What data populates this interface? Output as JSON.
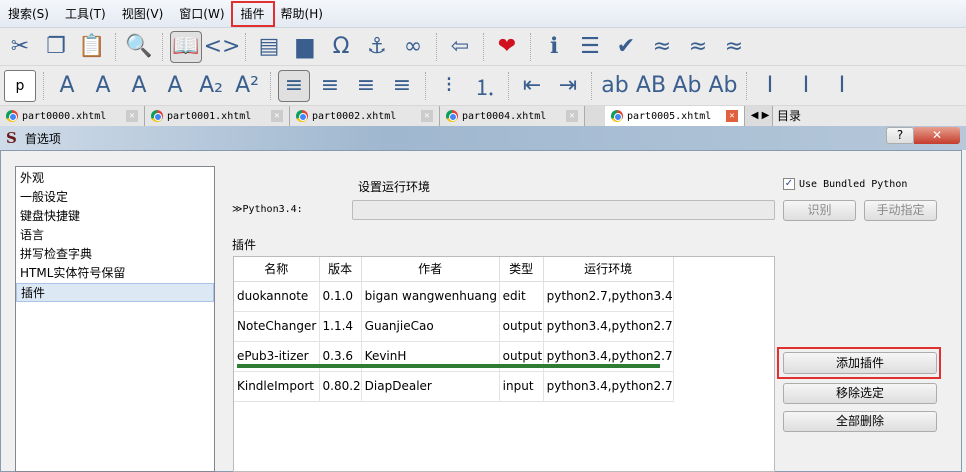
{
  "menu": [
    "搜索(S)",
    "工具(T)",
    "视图(V)",
    "窗口(W)",
    "插件",
    "帮助(H)"
  ],
  "toolbar1": [
    {
      "icon": "cut-icon",
      "g": "✂"
    },
    {
      "icon": "copy-icon",
      "g": "❐"
    },
    {
      "icon": "paste-icon",
      "g": "📋"
    },
    {
      "icon": "preview-icon",
      "g": "🔍"
    },
    {
      "icon": "book-view-icon",
      "g": "📖"
    },
    {
      "icon": "code-view-icon",
      "g": "<>"
    },
    {
      "icon": "split-icon",
      "g": "▤"
    },
    {
      "icon": "image-icon",
      "g": "▆"
    },
    {
      "icon": "omega-icon",
      "g": "Ω"
    },
    {
      "icon": "anchor-icon",
      "g": "⚓"
    },
    {
      "icon": "link-icon",
      "g": "∞"
    },
    {
      "icon": "back-icon",
      "g": "⇦"
    },
    {
      "icon": "heart-icon",
      "g": "❤"
    },
    {
      "icon": "info-icon",
      "g": "ℹ"
    },
    {
      "icon": "toc-icon",
      "g": "☰"
    },
    {
      "icon": "spellcheck-icon",
      "g": "✔"
    },
    {
      "icon": "clean-icon",
      "g": "≈"
    },
    {
      "icon": "clean2-icon",
      "g": "≈"
    },
    {
      "icon": "clean3-icon",
      "g": "≈"
    }
  ],
  "toolbar2": [
    {
      "icon": "paragraph-icon",
      "g": "p"
    },
    {
      "icon": "bold-icon",
      "g": "A"
    },
    {
      "icon": "italic-icon",
      "g": "A"
    },
    {
      "icon": "underline-icon",
      "g": "A"
    },
    {
      "icon": "strike-icon",
      "g": "A"
    },
    {
      "icon": "subscript-icon",
      "g": "A₂"
    },
    {
      "icon": "superscript-icon",
      "g": "A²"
    },
    {
      "icon": "align-left-icon",
      "g": "≡"
    },
    {
      "icon": "align-center-icon",
      "g": "≡"
    },
    {
      "icon": "align-right-icon",
      "g": "≡"
    },
    {
      "icon": "justify-icon",
      "g": "≡"
    },
    {
      "icon": "bullet-list-icon",
      "g": "⁝"
    },
    {
      "icon": "number-list-icon",
      "g": "⒈"
    },
    {
      "icon": "outdent-icon",
      "g": "⇤"
    },
    {
      "icon": "indent-icon",
      "g": "⇥"
    },
    {
      "icon": "lowercase-icon",
      "g": "ab"
    },
    {
      "icon": "uppercase-icon",
      "g": "AB"
    },
    {
      "icon": "titlecase-icon",
      "g": "Ab"
    },
    {
      "icon": "capitalize-icon",
      "g": "Ab"
    },
    {
      "icon": "ltr-icon",
      "g": "I"
    },
    {
      "icon": "rtl-icon",
      "g": "I"
    },
    {
      "icon": "vertical-icon",
      "g": "I"
    }
  ],
  "tabs": [
    "part0000.xhtml",
    "part0001.xhtml",
    "part0002.xhtml",
    "part0004.xhtml",
    "part0005.xhtml"
  ],
  "toc_label": "目录",
  "dialog": {
    "title": "首选项",
    "help": "?",
    "close": "✕"
  },
  "sidebar": [
    "外观",
    "一般设定",
    "键盘快捷键",
    "语言",
    "拼写检查字典",
    "HTML实体符号保留",
    "插件"
  ],
  "env": {
    "heading": "设置运行环境",
    "python_label": "≫Python3.4:",
    "python_value": "",
    "bundled": "Use Bundled Python",
    "identify": "识别",
    "manual": "手动指定"
  },
  "plugins": {
    "label": "插件",
    "columns": [
      "名称",
      "版本",
      "作者",
      "类型",
      "运行环境"
    ],
    "rows": [
      [
        "duokannote",
        "0.1.0",
        "bigan wangwenhuang",
        "edit",
        "python2.7,python3.4"
      ],
      [
        "NoteChanger",
        "1.1.4",
        "GuanjieCao",
        "output",
        "python3.4,python2.7"
      ],
      [
        "ePub3-itizer",
        "0.3.6",
        "KevinH",
        "output",
        "python3.4,python2.7"
      ],
      [
        "KindleImport",
        "0.80.2",
        "DiapDealer",
        "input",
        "python3.4,python2.7"
      ]
    ]
  },
  "buttons": {
    "add": "添加插件",
    "remove": "移除选定",
    "remove_all": "全部删除"
  }
}
